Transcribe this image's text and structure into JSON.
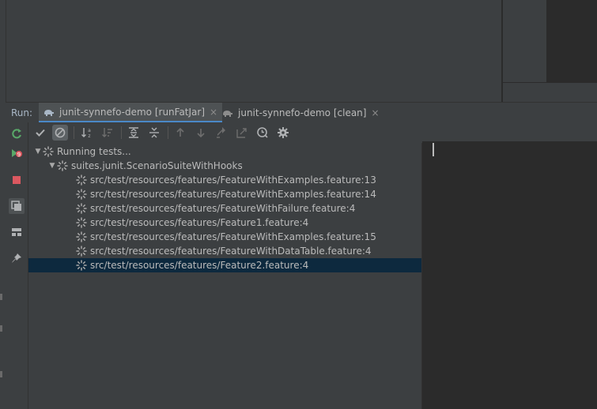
{
  "run_panel": {
    "label": "Run:",
    "tabs": [
      {
        "label": "junit-synnefo-demo [runFatJar]",
        "active": true,
        "close": "×",
        "icon": "gradle-elephant-icon"
      },
      {
        "label": "junit-synnefo-demo [clean]",
        "active": false,
        "close": "×",
        "icon": "gradle-elephant-icon"
      }
    ]
  },
  "vertical_toolbar": [
    {
      "name": "rerun-button",
      "icon": "rerun-icon"
    },
    {
      "name": "rerun-failed-button",
      "icon": "rerun-failed-icon"
    },
    {
      "name": "stop-button",
      "icon": "stop-icon"
    },
    {
      "name": "restore-layout-button",
      "icon": "layout-icon"
    },
    {
      "name": "split-view-button",
      "icon": "split-icon"
    },
    {
      "name": "pin-tab-button",
      "icon": "pin-icon"
    }
  ],
  "horizontal_toolbar": [
    {
      "name": "show-passed-button",
      "icon": "check-icon"
    },
    {
      "name": "show-ignored-button",
      "icon": "ignored-icon",
      "selected": true
    },
    {
      "name": "sort-alphabetically-button",
      "icon": "sort-alpha-icon"
    },
    {
      "name": "sort-by-duration-button",
      "icon": "sort-duration-icon"
    },
    {
      "name": "expand-all-button",
      "icon": "expand-all-icon"
    },
    {
      "name": "collapse-all-button",
      "icon": "collapse-all-icon"
    },
    {
      "name": "previous-failed-button",
      "icon": "arrow-up-icon"
    },
    {
      "name": "next-failed-button",
      "icon": "arrow-down-icon"
    },
    {
      "name": "import-tests-button",
      "icon": "import-icon"
    },
    {
      "name": "export-tests-button",
      "icon": "export-icon"
    },
    {
      "name": "test-history-button",
      "icon": "history-icon"
    },
    {
      "name": "settings-button",
      "icon": "gear-icon"
    }
  ],
  "tree": {
    "root": {
      "label": "Running tests..."
    },
    "suite": {
      "label": "suites.junit.ScenarioSuiteWithHooks"
    },
    "items": [
      {
        "label": "src/test/resources/features/FeatureWithExamples.feature:13"
      },
      {
        "label": "src/test/resources/features/FeatureWithExamples.feature:14"
      },
      {
        "label": "src/test/resources/features/FeatureWithFailure.feature:4"
      },
      {
        "label": "src/test/resources/features/Feature1.feature:4"
      },
      {
        "label": "src/test/resources/features/FeatureWithExamples.feature:15"
      },
      {
        "label": "src/test/resources/features/FeatureWithDataTable.feature:4"
      },
      {
        "label": "src/test/resources/features/Feature2.feature:4",
        "selected": true
      }
    ]
  },
  "colors": {
    "background": "#3c3f41",
    "console_bg": "#2b2b2b",
    "selection": "#0d293e",
    "text": "#bbbbbb",
    "accent": "#4a88c7",
    "rerun_green": "#59a869",
    "stop_red": "#db5860"
  }
}
